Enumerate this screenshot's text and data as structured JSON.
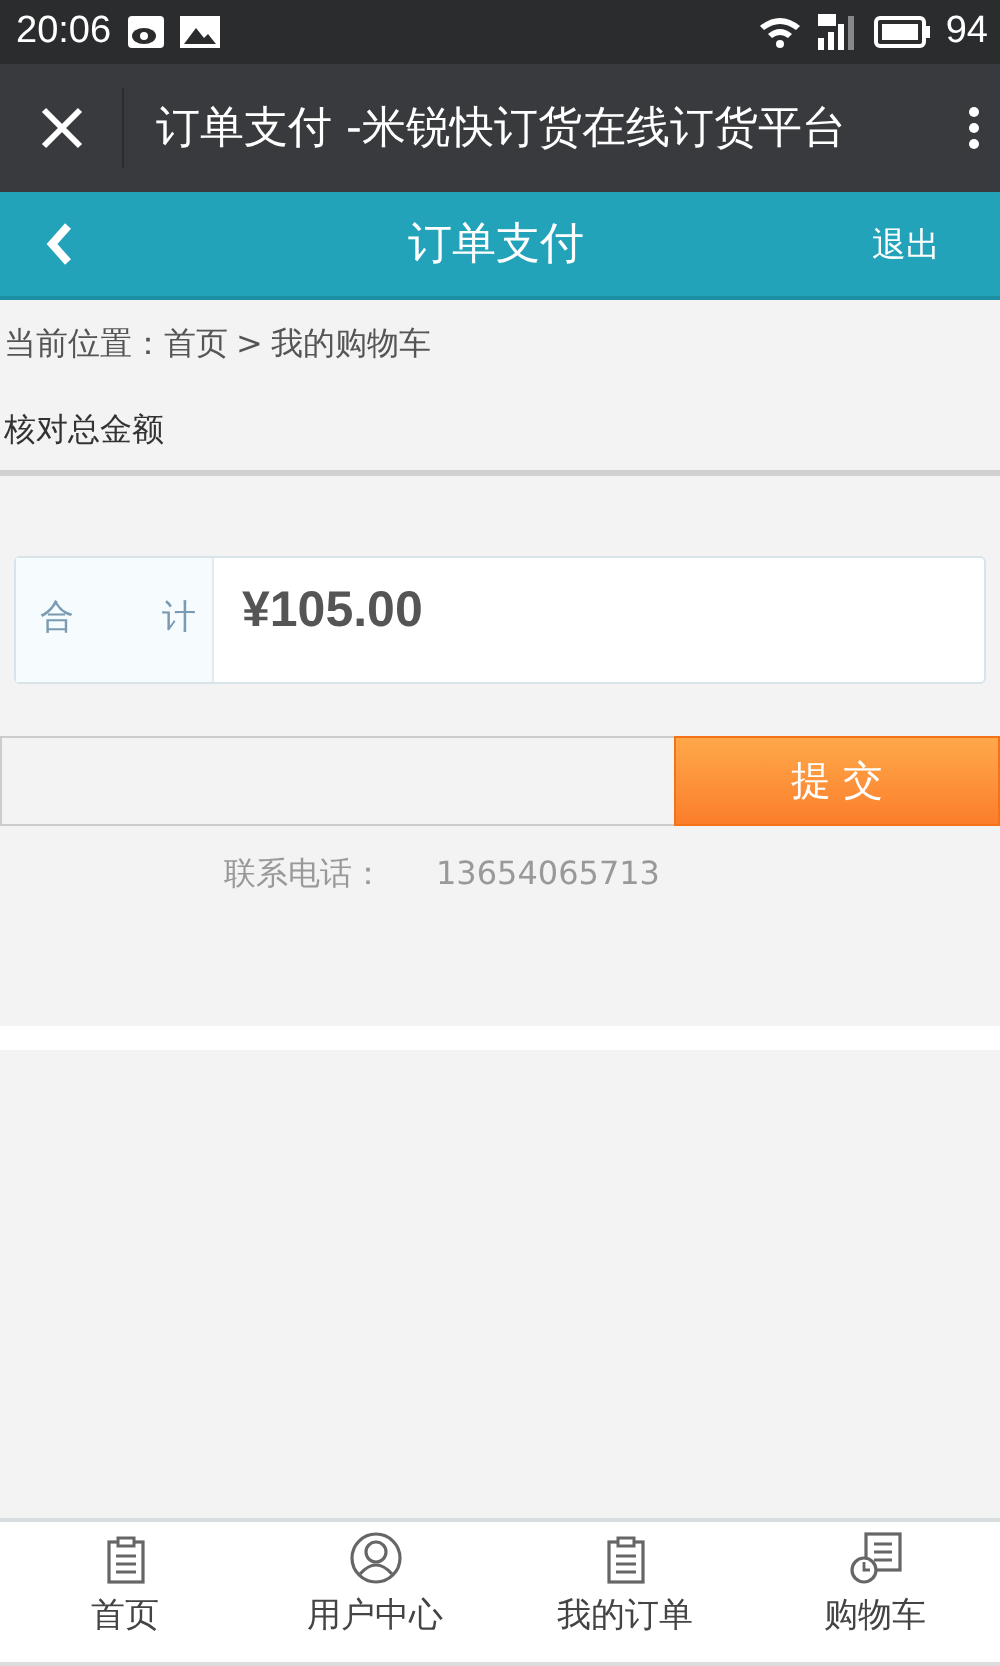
{
  "status_bar": {
    "time": "20:06",
    "battery": "94"
  },
  "browser_bar": {
    "title": "订单支付 -米锐快订货在线订货平台"
  },
  "header": {
    "title": "订单支付",
    "action": "退出"
  },
  "breadcrumb": {
    "label": "当前位置：",
    "items": [
      "首页",
      "我的购物车"
    ],
    "separator": ">"
  },
  "section_title": "核对总金额",
  "total": {
    "label_1": "合",
    "label_2": "计",
    "amount": "¥105.00"
  },
  "submit": {
    "button": "提 交"
  },
  "contact": {
    "label": "联系电话：",
    "phone": "13654065713"
  },
  "tabs": [
    {
      "label": "首页",
      "kind": "clipboard"
    },
    {
      "label": "用户中心",
      "kind": "user"
    },
    {
      "label": "我的订单",
      "kind": "clipboard"
    },
    {
      "label": "购物车",
      "kind": "clock"
    }
  ]
}
